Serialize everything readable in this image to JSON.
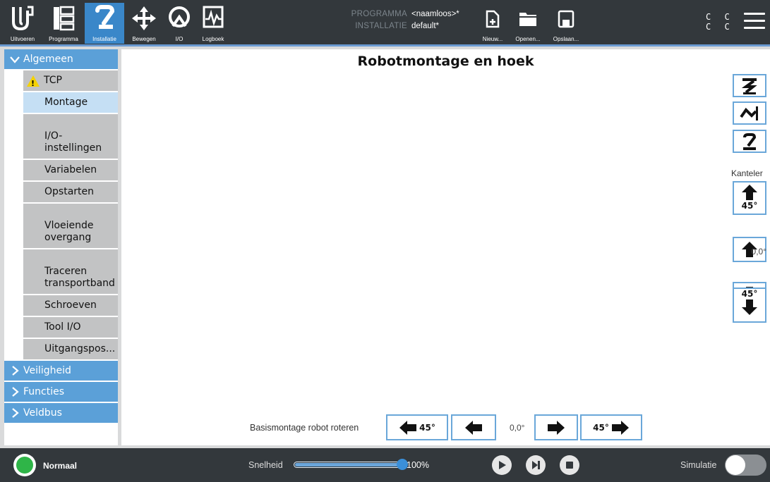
{
  "nav": {
    "items": [
      {
        "label": "Uitvoeren",
        "icon": "ur-logo-icon"
      },
      {
        "label": "Programma",
        "icon": "program-icon"
      },
      {
        "label": "Installatie",
        "icon": "robot-arm-icon",
        "active": true
      },
      {
        "label": "Bewegen",
        "icon": "move-arrows-icon"
      },
      {
        "label": "I/O",
        "icon": "io-icon"
      },
      {
        "label": "Logboek",
        "icon": "log-icon"
      }
    ]
  },
  "program": {
    "program_key": "PROGRAMMA",
    "program_value": "<naamloos>*",
    "install_key": "INSTALLATIE",
    "install_value": "default*"
  },
  "file_buttons": {
    "new": "Nieuw...",
    "open": "Openen...",
    "save": "Opslaan..."
  },
  "status_cc": {
    "line1": "C C",
    "line2": "C C"
  },
  "sidebar": {
    "sections": [
      "Algemeen",
      "Veiligheid",
      "Functies",
      "Veldbus"
    ],
    "items": [
      "TCP",
      "Montage",
      "I/O-\ninstellingen",
      "Variabelen",
      "Opstarten",
      "Vloeiende\novergang",
      "Traceren\ntransportband",
      "Schroeven",
      "Tool I/O",
      "Uitgangspos..."
    ],
    "selected": "Montage"
  },
  "main": {
    "title": "Robotmontage en hoek",
    "tilt_label": "Kanteler",
    "tilt_step_deg": "45°",
    "tilt_value": "0,0°",
    "rotate_label": "Basismontage robot roteren",
    "rotate_step_deg": "45°",
    "rotate_value": "0,0°"
  },
  "bottom": {
    "status": "Normaal",
    "status_color": "#2fb548",
    "speed_label": "Snelheid",
    "speed_value": "100%",
    "speed_fraction": 1.0,
    "sim_label": "Simulatie",
    "sim_on": false
  },
  "colors": {
    "accent": "#5ba0d8",
    "topbar": "#33383c",
    "button_border": "#6aa7d9"
  }
}
